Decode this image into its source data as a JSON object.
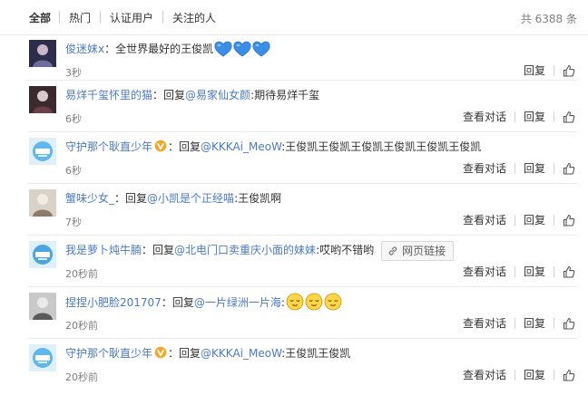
{
  "tabs": [
    {
      "label": "全部",
      "active": true
    },
    {
      "label": "热门",
      "active": false
    },
    {
      "label": "认证用户",
      "active": false
    },
    {
      "label": "关注的人",
      "active": false
    }
  ],
  "total": "共 6388 条",
  "actions": {
    "reply": "回复",
    "view_conversation": "查看对话"
  },
  "comments": [
    {
      "user": "俊迷妹x",
      "verified": false,
      "reply_to": "",
      "text": "全世界最好的王俊凯",
      "emoji": [
        "blue-heart",
        "blue-heart",
        "blue-heart"
      ],
      "link": "",
      "time": "3秒",
      "has_conversation": false
    },
    {
      "user": "易烊千玺怀里的猫",
      "verified": false,
      "reply_to": "@易家仙女颜",
      "text": ":期待易烊千玺",
      "emoji": [],
      "link": "",
      "time": "6秒",
      "has_conversation": true
    },
    {
      "user": "守护那个耿直少年",
      "verified": true,
      "reply_to": "@KKKAi_MeoW",
      "text": ":王俊凯王俊凯王俊凯王俊凯王俊凯王俊凯",
      "emoji": [],
      "link": "",
      "time": "6秒",
      "has_conversation": true
    },
    {
      "user": "蟹味少女_",
      "verified": false,
      "reply_to": "@小凯是个正经喵",
      "text": ":王俊凯啊",
      "emoji": [],
      "link": "",
      "time": "7秒",
      "has_conversation": true
    },
    {
      "user": "我是萝卜炖牛腩",
      "verified": false,
      "reply_to": "@北电门口卖重庆小面的妹妹",
      "text": ":哎哟不错哟",
      "emoji": [],
      "link": "网页链接",
      "time": "20秒前",
      "has_conversation": true
    },
    {
      "user": "捏捏小肥脸201707",
      "verified": false,
      "reply_to": "@一片绿洲一片海",
      "text": ":",
      "emoji": [
        "relieved-face",
        "relieved-face",
        "relieved-face"
      ],
      "link": "",
      "time": "20秒前",
      "has_conversation": true
    },
    {
      "user": "守护那个耿直少年",
      "verified": true,
      "reply_to": "@KKKAi_MeoW",
      "text": ":王俊凯王俊凯",
      "emoji": [],
      "link": "",
      "time": "20秒前",
      "has_conversation": true
    }
  ],
  "reply_prefix": "回复",
  "separator": "：",
  "colors": {
    "link_blue": "#4b7ac2",
    "muted": "#808080",
    "verified_gold": "#f5a623",
    "heart_blue": "#3a8ee6",
    "emoji_face": "#ffd54a"
  }
}
